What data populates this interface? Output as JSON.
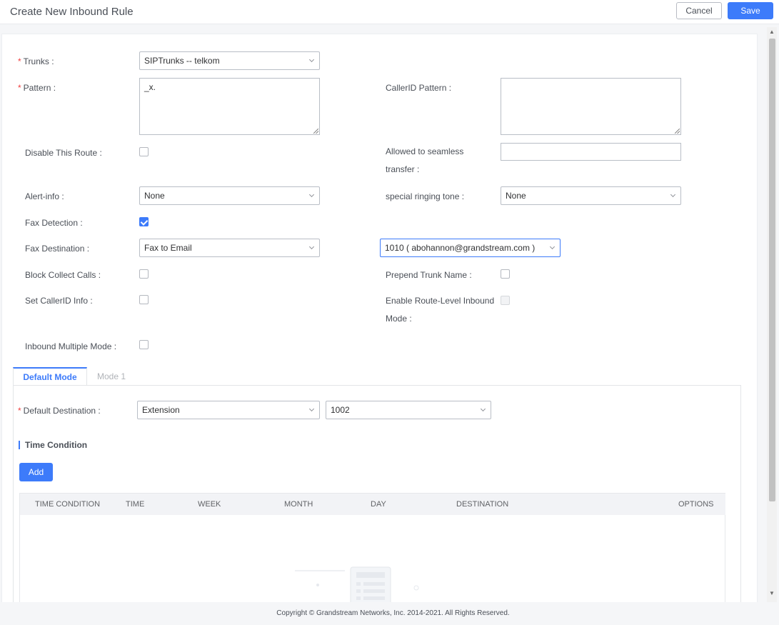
{
  "header": {
    "title": "Create New Inbound Rule",
    "cancel_label": "Cancel",
    "save_label": "Save"
  },
  "form": {
    "trunks": {
      "label": "Trunks :",
      "value": "SIPTrunks -- telkom",
      "required": true
    },
    "pattern": {
      "label": "Pattern :",
      "value": "_x.",
      "required": true
    },
    "callerid_pattern": {
      "label": "CallerID Pattern :",
      "value": ""
    },
    "disable_route": {
      "label": "Disable This Route :",
      "checked": false
    },
    "allowed_seamless": {
      "label": "Allowed to seamless transfer :",
      "value": ""
    },
    "alert_info": {
      "label": "Alert-info :",
      "value": "None"
    },
    "special_ringing": {
      "label": "special ringing tone :",
      "value": "None"
    },
    "fax_detection": {
      "label": "Fax Detection :",
      "checked": true
    },
    "fax_destination": {
      "label": "Fax Destination :",
      "value": "Fax to Email",
      "email_value": "1010 ( abohannon@grandstream.com )"
    },
    "block_collect": {
      "label": "Block Collect Calls :",
      "checked": false
    },
    "prepend_trunk": {
      "label": "Prepend Trunk Name :",
      "checked": false
    },
    "set_callerid": {
      "label": "Set CallerID Info :",
      "checked": false
    },
    "route_level_inbound": {
      "label": "Enable Route-Level Inbound Mode :",
      "checked": false,
      "disabled": true
    },
    "inbound_multiple": {
      "label": "Inbound Multiple Mode :",
      "checked": false
    }
  },
  "tabs": [
    {
      "label": "Default Mode",
      "active": true
    },
    {
      "label": "Mode 1",
      "active": false
    }
  ],
  "default_destination": {
    "label": "Default Destination :",
    "type_value": "Extension",
    "target_value": "1002",
    "required": true
  },
  "time_condition": {
    "title": "Time Condition",
    "add_label": "Add",
    "columns": [
      "TIME CONDITION",
      "TIME",
      "WEEK",
      "MONTH",
      "DAY",
      "DESTINATION",
      "OPTIONS"
    ],
    "rows": []
  },
  "footer": {
    "copyright": "Copyright © Grandstream Networks, Inc. 2014-2021. All Rights Reserved."
  },
  "colors": {
    "accent": "#3d7bfa",
    "required": "#f04040"
  }
}
